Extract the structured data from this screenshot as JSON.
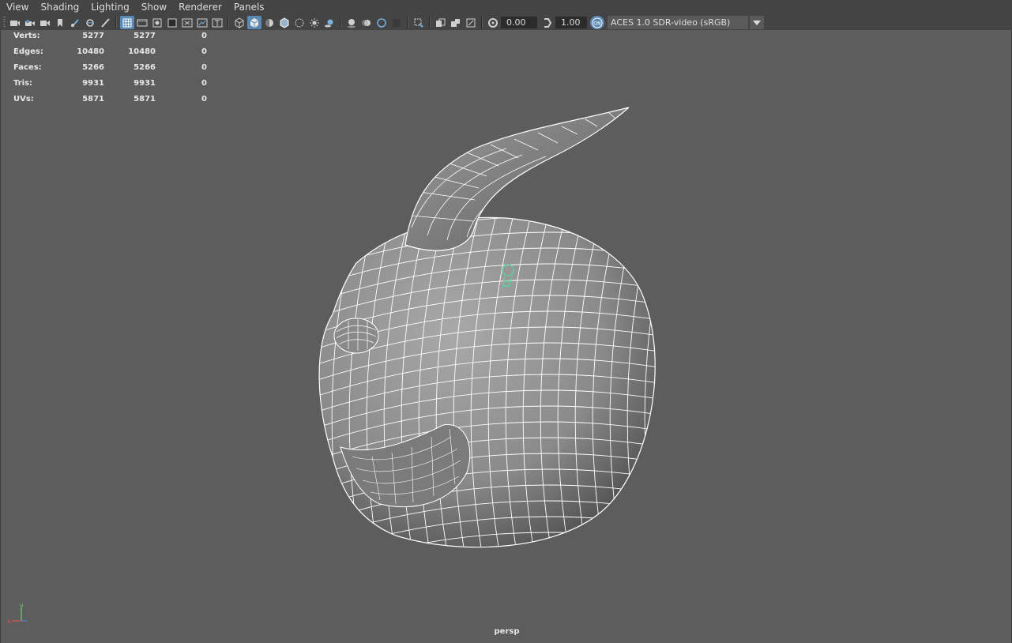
{
  "menu": [
    "View",
    "Shading",
    "Lighting",
    "Show",
    "Renderer",
    "Panels"
  ],
  "toolbar": {
    "exposure_value": "0.00",
    "gamma_value": "1.00",
    "color_space": "ACES 1.0 SDR-video (sRGB)",
    "icons": [
      "camera-select-icon",
      "camera-attributes-icon",
      "camera-bookmark-icon",
      "image-plane-icon",
      "grease-pencil-icon",
      "2d-pan-zoom-icon",
      "grid-icon",
      "film-gate-icon",
      "resolution-gate-icon",
      "gate-mask-icon",
      "field-chart-icon",
      "safe-action-icon",
      "safe-title-icon",
      "wireframe-icon",
      "smooth-shade-icon",
      "default-material-icon",
      "wireframe-on-shaded-icon",
      "xray-icon",
      "use-all-lights-icon",
      "shadows-icon",
      "ambient-occlusion-icon",
      "motion-blur-icon",
      "anti-alias-icon",
      "depth-of-field-icon",
      "isolate-select-icon",
      "xray-joints-icon",
      "xray-active-icon",
      "backface-culling-icon",
      "exposure-icon",
      "gamma-icon",
      "color-management-icon"
    ]
  },
  "hud": [
    {
      "label": "Verts:",
      "a": "5277",
      "b": "5277",
      "c": "0"
    },
    {
      "label": "Edges:",
      "a": "10480",
      "b": "10480",
      "c": "0"
    },
    {
      "label": "Faces:",
      "a": "5266",
      "b": "5266",
      "c": "0"
    },
    {
      "label": "Tris:",
      "a": "9931",
      "b": "9931",
      "c": "0"
    },
    {
      "label": "UVs:",
      "a": "5871",
      "b": "5871",
      "c": "0"
    }
  ],
  "camera_label": "persp",
  "axis": {
    "x": "x",
    "y": "y"
  },
  "colors": {
    "background": "#5d5d5d",
    "panel": "#444444",
    "active": "#5a89b4",
    "highlight": "#55d6a0"
  }
}
